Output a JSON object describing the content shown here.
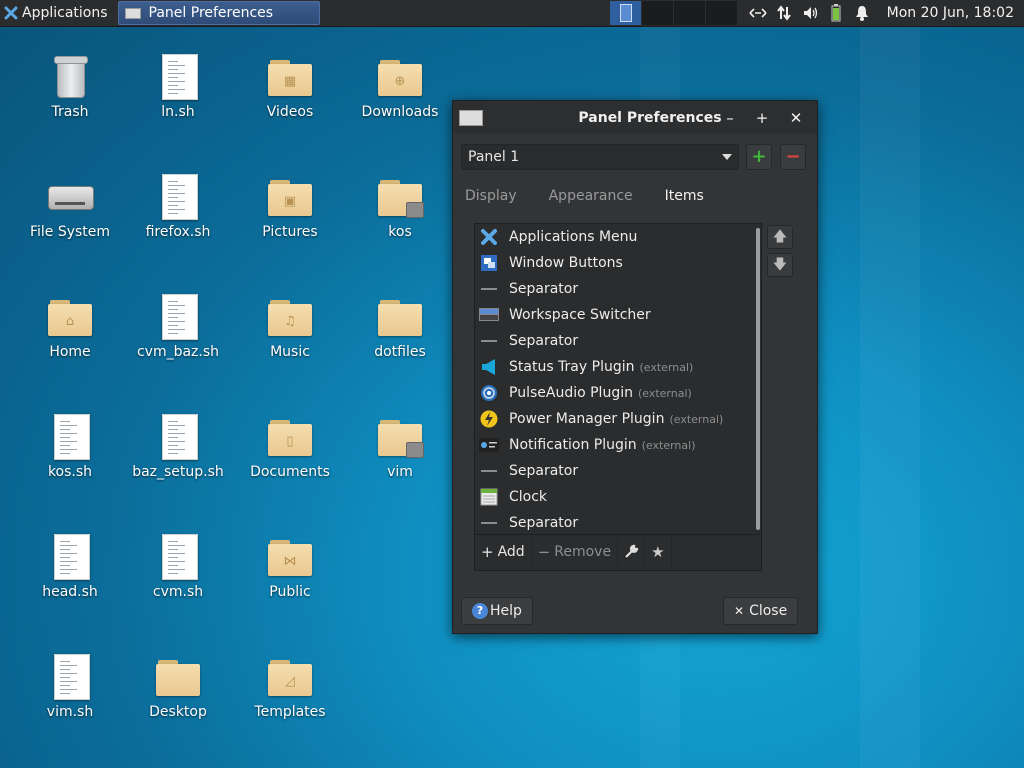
{
  "panel": {
    "applications_label": "Applications",
    "task_title": "Panel Preferences",
    "clock": "Mon 20 Jun, 18:02",
    "tray_icons": [
      "network-arrows-icon",
      "transfer-icon",
      "volume-icon",
      "battery-icon",
      "bell-icon"
    ]
  },
  "desktop": {
    "icons": [
      {
        "label": "Trash",
        "icon": "trash-icon"
      },
      {
        "label": "ln.sh",
        "icon": "script-icon"
      },
      {
        "label": "Videos",
        "icon": "folder-videos-icon"
      },
      {
        "label": "Downloads",
        "icon": "folder-downloads-icon"
      },
      {
        "label": "File System",
        "icon": "drive-icon"
      },
      {
        "label": "firefox.sh",
        "icon": "script-icon"
      },
      {
        "label": "Pictures",
        "icon": "folder-pictures-icon"
      },
      {
        "label": "kos",
        "icon": "folder-locked-icon"
      },
      {
        "label": "Home",
        "icon": "folder-home-icon"
      },
      {
        "label": "cvm_baz.sh",
        "icon": "script-icon"
      },
      {
        "label": "Music",
        "icon": "folder-music-icon"
      },
      {
        "label": "dotfiles",
        "icon": "folder-icon"
      },
      {
        "label": "kos.sh",
        "icon": "script-icon"
      },
      {
        "label": "baz_setup.sh",
        "icon": "script-icon"
      },
      {
        "label": "Documents",
        "icon": "folder-documents-icon"
      },
      {
        "label": "vim",
        "icon": "folder-locked-icon"
      },
      {
        "label": "head.sh",
        "icon": "script-icon"
      },
      {
        "label": "cvm.sh",
        "icon": "script-icon"
      },
      {
        "label": "Public",
        "icon": "folder-public-icon"
      },
      {
        "label": "vim.sh",
        "icon": "script-icon"
      },
      {
        "label": "Desktop",
        "icon": "folder-icon"
      },
      {
        "label": "Templates",
        "icon": "folder-templates-icon"
      }
    ]
  },
  "dialog": {
    "title": "Panel Preferences",
    "panel_select": "Panel 1",
    "tabs": [
      "Display",
      "Appearance",
      "Items"
    ],
    "active_tab": "Items",
    "items": [
      {
        "label": "Applications Menu",
        "icon": "xfce-logo-icon",
        "external": ""
      },
      {
        "label": "Window Buttons",
        "icon": "windows-icon",
        "external": ""
      },
      {
        "label": "Separator",
        "icon": "separator-icon",
        "external": ""
      },
      {
        "label": "Workspace Switcher",
        "icon": "workspace-icon",
        "external": ""
      },
      {
        "label": "Separator",
        "icon": "separator-icon",
        "external": ""
      },
      {
        "label": "Status Tray Plugin",
        "icon": "megaphone-icon",
        "external": "(external)"
      },
      {
        "label": "PulseAudio Plugin",
        "icon": "speaker-icon",
        "external": "(external)"
      },
      {
        "label": "Power Manager Plugin",
        "icon": "lightning-icon",
        "external": "(external)"
      },
      {
        "label": "Notification Plugin",
        "icon": "notification-icon",
        "external": "(external)"
      },
      {
        "label": "Separator",
        "icon": "separator-icon",
        "external": ""
      },
      {
        "label": "Clock",
        "icon": "calendar-icon",
        "external": ""
      },
      {
        "label": "Separator",
        "icon": "separator-icon",
        "external": ""
      }
    ],
    "add_label": "Add",
    "remove_label": "Remove",
    "help_label": "Help",
    "close_label": "Close",
    "colors": {
      "accent": "#4a86d8",
      "add_green": "#3fb73f",
      "remove_red": "#e04343"
    }
  }
}
